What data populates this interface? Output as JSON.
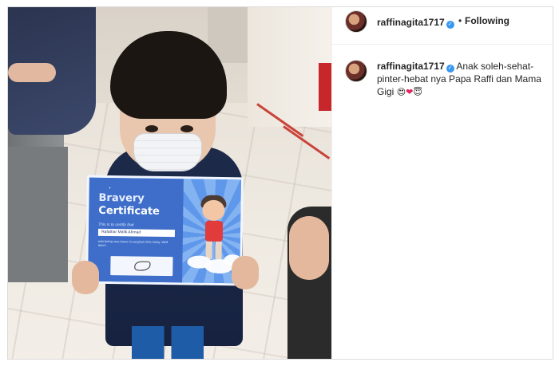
{
  "post": {
    "username": "raffinagita1717",
    "verified_icon": "verified-badge-icon",
    "separator": "•",
    "follow_status": "Following"
  },
  "caption": {
    "username": "raffinagita1717",
    "text": "Anak soleh-sehat-pinter-hebat nya Papa Raffi dan Mama Gigi",
    "emojis": [
      "😍",
      "❤",
      "😇"
    ]
  },
  "photo": {
    "certificate": {
      "title_line1": "Bravery",
      "title_line2": "Certificate",
      "certify_text": "This is to certify that",
      "recipient_name": "Rafathar Malik Ahmad",
      "body_text": "was being very brave in surgical clinic today. Well done!"
    }
  },
  "colors": {
    "verified_blue": "#3897f0",
    "border": "#dbdbdb",
    "text": "#262626"
  }
}
